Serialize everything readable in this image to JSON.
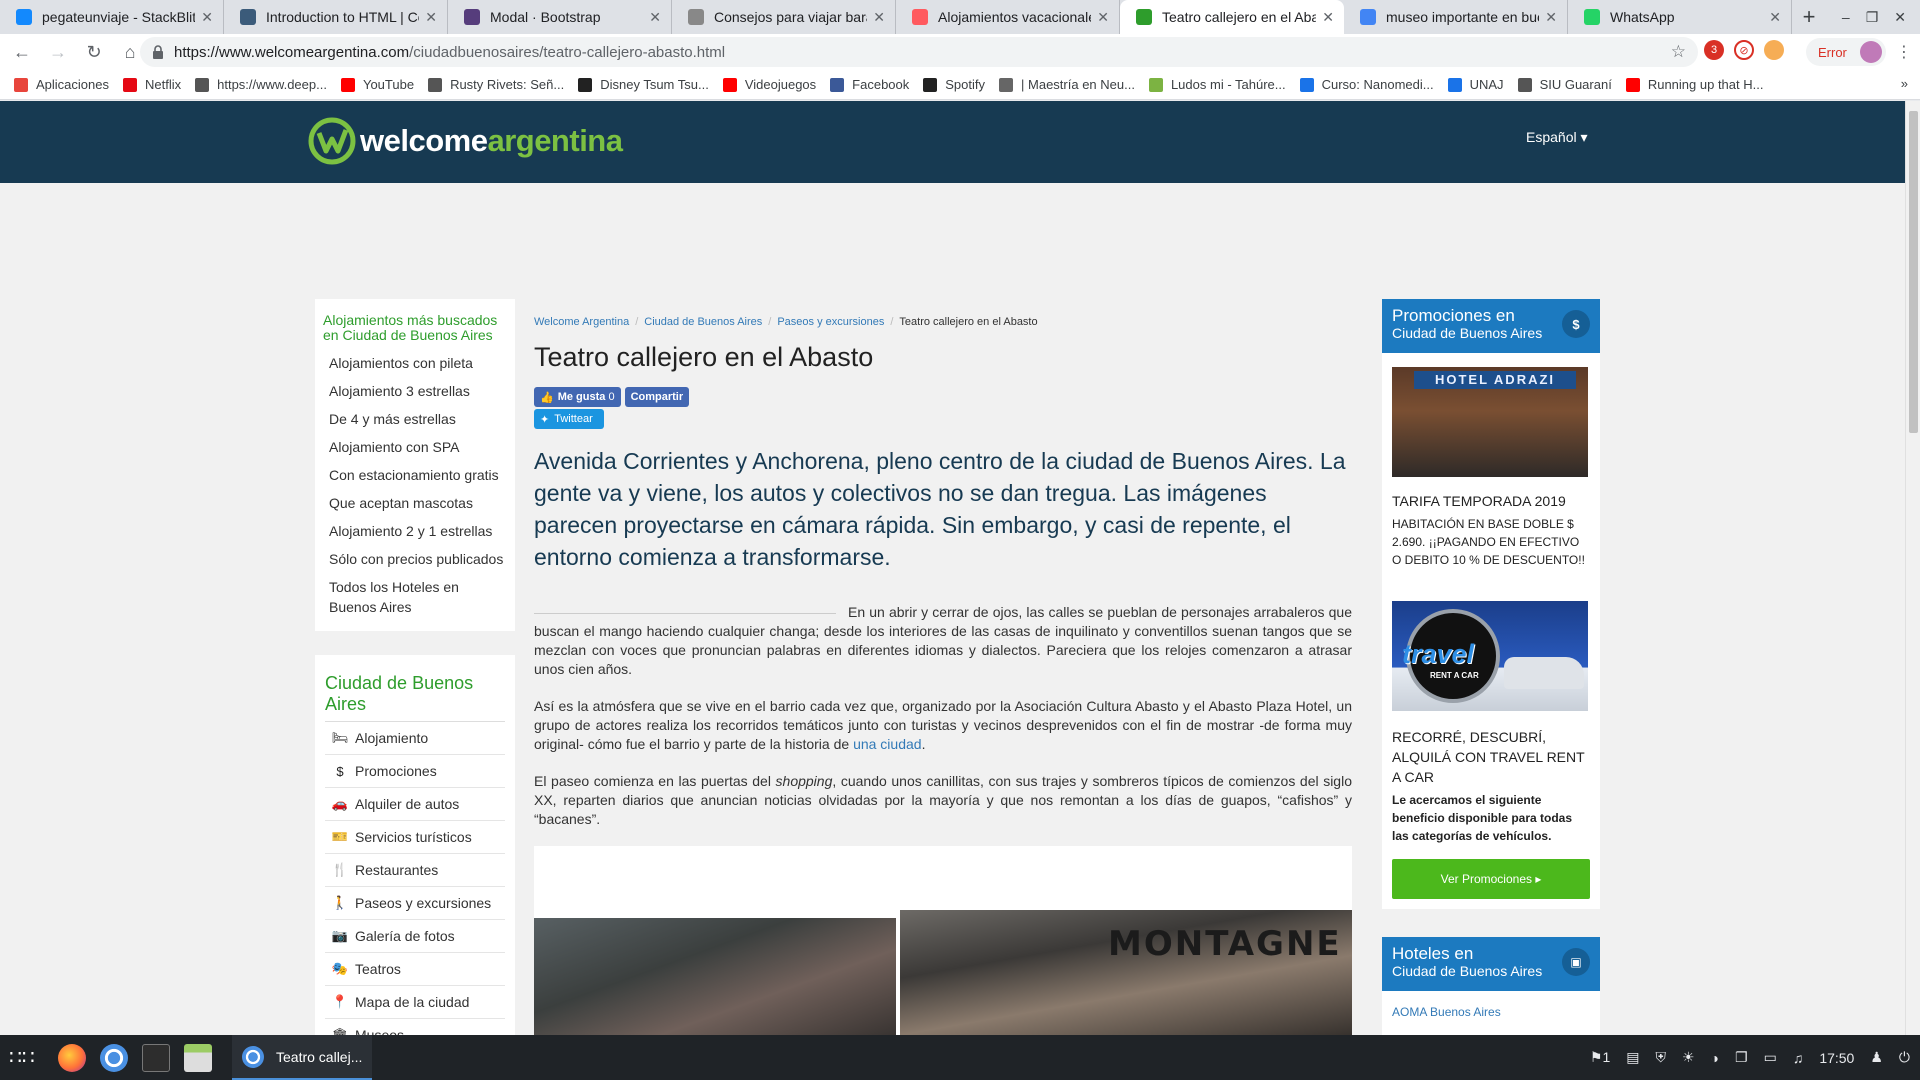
{
  "browser": {
    "tabs": [
      {
        "title": "pegateunviaje - StackBlitz",
        "icon": "bolt-icon",
        "color": "#1389fd"
      },
      {
        "title": "Introduction to HTML | Coo",
        "icon": "doc-icon",
        "color": "#3b5b7a"
      },
      {
        "title": "Modal · Bootstrap",
        "icon": "bootstrap-icon",
        "color": "#563d7c"
      },
      {
        "title": "Consejos para viajar barato",
        "icon": "gear-icon",
        "color": "#888888"
      },
      {
        "title": "Alojamientos vacacionales",
        "icon": "airbnb-icon",
        "color": "#ff5a5f"
      },
      {
        "title": "Teatro callejero en el Abas",
        "icon": "welcome-icon",
        "color": "#2e9d2c"
      },
      {
        "title": "museo importante en buen",
        "icon": "google-icon",
        "color": "#4285f4"
      },
      {
        "title": "WhatsApp",
        "icon": "whatsapp-icon",
        "color": "#25d366"
      }
    ],
    "url_host": "https://www.welcomeargentina.com",
    "url_path": "/ciudadbuenosaires/teatro-callejero-abasto.html",
    "error_label": "Error",
    "bookmarks": [
      {
        "label": "Aplicaciones",
        "icon": "apps-grid-icon",
        "color": "#e8453c"
      },
      {
        "label": "Netflix",
        "icon": "netflix-icon",
        "color": "#e50914"
      },
      {
        "label": "https://www.deep...",
        "icon": "globe-icon",
        "color": "#555555"
      },
      {
        "label": "YouTube",
        "icon": "youtube-icon",
        "color": "#ff0000"
      },
      {
        "label": "Rusty Rivets: Señ...",
        "icon": "globe-icon",
        "color": "#555555"
      },
      {
        "label": "Disney Tsum Tsu...",
        "icon": "disney-icon",
        "color": "#222222"
      },
      {
        "label": "Videojuegos",
        "icon": "youtube-icon",
        "color": "#ff0000"
      },
      {
        "label": "Facebook",
        "icon": "facebook-icon",
        "color": "#3b5998"
      },
      {
        "label": "Spotify",
        "icon": "spotify-icon",
        "color": "#222222"
      },
      {
        "label": "| Maestría en Neu...",
        "icon": "mail-icon",
        "color": "#666666"
      },
      {
        "label": "Ludos mi - Tahúre...",
        "icon": "ludos-icon",
        "color": "#7cb342"
      },
      {
        "label": "Curso: Nanomedi...",
        "icon": "course-icon",
        "color": "#1a73e8"
      },
      {
        "label": "UNAJ",
        "icon": "unaj-icon",
        "color": "#1a73e8"
      },
      {
        "label": "SIU Guaraní",
        "icon": "globe-icon",
        "color": "#555555"
      },
      {
        "label": "Running up that H...",
        "icon": "youtube-icon",
        "color": "#ff0000"
      }
    ]
  },
  "site": {
    "logo_welcome": "welcome",
    "logo_argentina": "argentina",
    "language": "Español"
  },
  "sidebar": {
    "searched_title": "Alojamientos más buscados en Ciudad de Buenos Aires",
    "searched_links": [
      "Alojamientos con pileta",
      "Alojamiento 3 estrellas",
      "De 4 y más estrellas",
      "Alojamiento con SPA",
      "Con estacionamiento gratis",
      "Que aceptan mascotas",
      "Alojamiento 2 y 1 estrellas",
      "Sólo con precios publicados",
      "Todos los Hoteles en Buenos Aires"
    ],
    "city_title": "Ciudad de Buenos Aires",
    "city_links": [
      {
        "label": "Alojamiento",
        "icon": "bed-icon",
        "glyph": "🛏"
      },
      {
        "label": "Promociones",
        "icon": "dollar-icon",
        "glyph": "$"
      },
      {
        "label": "Alquiler de autos",
        "icon": "car-icon",
        "glyph": "🚗"
      },
      {
        "label": "Servicios turísticos",
        "icon": "ticket-icon",
        "glyph": "🎫"
      },
      {
        "label": "Restaurantes",
        "icon": "cutlery-icon",
        "glyph": "🍴"
      },
      {
        "label": "Paseos y excursiones",
        "icon": "walking-icon",
        "glyph": "🚶"
      },
      {
        "label": "Galería de fotos",
        "icon": "camera-icon",
        "glyph": "📷"
      },
      {
        "label": "Teatros",
        "icon": "theater-icon",
        "glyph": "🎭"
      },
      {
        "label": "Mapa de la ciudad",
        "icon": "map-pin-icon",
        "glyph": "📍"
      },
      {
        "label": "Museos",
        "icon": "museum-icon",
        "glyph": "🏛"
      }
    ]
  },
  "article": {
    "breadcrumb": [
      "Welcome Argentina",
      "Ciudad de Buenos Aires",
      "Paseos y excursiones",
      "Teatro callejero en el Abasto"
    ],
    "title": "Teatro callejero en el Abasto",
    "like_label": "Me gusta",
    "like_count": "0",
    "share_label": "Compartir",
    "tweet_label": "Twittear",
    "lead": "Avenida Corrientes y Anchorena, pleno centro de la ciudad de Buenos Aires. La gente va y viene, los autos y colectivos no se dan tregua. Las imágenes parecen proyectarse en cámara rápida. Sin embargo, y casi de repente, el entorno comienza a transformarse.",
    "p1": "En un abrir y cerrar de ojos, las calles se pueblan de personajes arrabaleros que buscan el mango haciendo cualquier changa; desde los interiores de las casas de inquilinato y conventillos suenan tangos que se mezclan con voces que pronuncian palabras en diferentes idiomas y dialectos. Pareciera que los relojes comenzaron a atrasar unos cien años.",
    "p2_before": "Así es la atmósfera que se vive en el barrio cada vez que, organizado por la Asociación Cultura Abasto y el Abasto Plaza Hotel, un grupo de actores realiza los recorridos temáticos junto con turistas y vecinos desprevenidos con el fin de mostrar -de forma muy original- cómo fue el barrio y parte de la historia de ",
    "p2_link": "una ciudad",
    "p2_after": ".",
    "p3_before": "El paseo comienza en las puertas del ",
    "p3_em": "shopping",
    "p3_after": ", cuando unos canillitas, con sus trajes y sombreros típicos de comienzos del siglo XX, reparten diarios que anuncian noticias olvidadas por la mayoría y que nos remontan a los días de guapos, “cafishos” y “bacanes”.",
    "photo_sign": "MONTAGNE"
  },
  "promos": {
    "head_line1": "Promociones en",
    "head_line2": "Ciudad de Buenos Aires",
    "badge": "$",
    "hotel_sign": "HOTEL ADRAZI",
    "hotel_title": "TARIFA TEMPORADA 2019",
    "hotel_text": " HABITACIÓN EN BASE DOBLE $ 2.690.  ¡¡PAGANDO EN EFECTIVO O DEBITO 10 % DE DESCUENTO!!",
    "travel_word": "travel",
    "travel_sub": "RENT A CAR",
    "travel_title": "RECORRÉ, DESCUBRÍ, ALQUILÁ CON TRAVEL RENT A CAR",
    "travel_text": "Le acercamos el siguiente beneficio disponible para todas las categorías de vehículos.",
    "button": "Ver Promociones"
  },
  "hotels": {
    "head_line1": "Hoteles en",
    "head_line2": "Ciudad de Buenos Aires",
    "first": "AOMA Buenos Aires"
  },
  "taskbar": {
    "task_title": "Teatro callej...",
    "notif_count": "1",
    "clock": "17:50"
  },
  "colors": {
    "header_bg": "#173a52",
    "accent_green": "#2e9d2c",
    "promo_blue": "#1c7ac0",
    "button_green": "#4cb81c"
  }
}
